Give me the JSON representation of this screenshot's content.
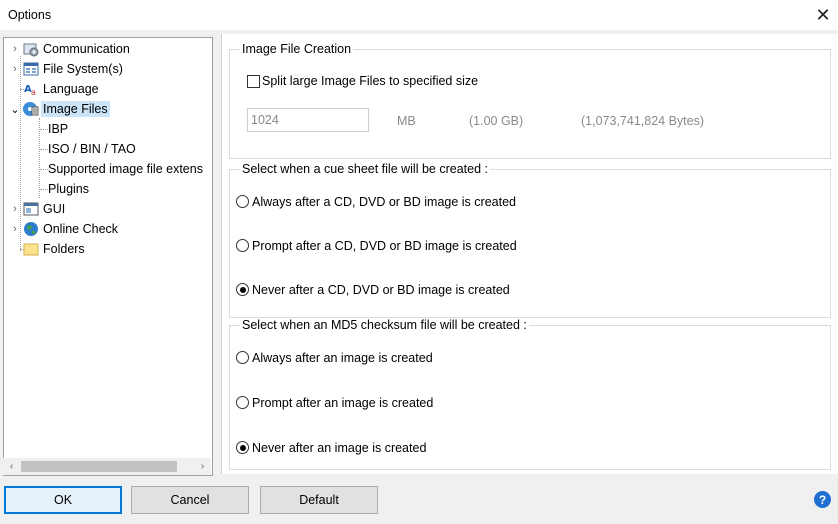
{
  "window": {
    "title": "Options",
    "close_glyph": "✕"
  },
  "tree": {
    "items": [
      {
        "label": "Communication",
        "icon": "network-settings-icon",
        "expander": "›"
      },
      {
        "label": "File System(s)",
        "icon": "filesystem-icon",
        "expander": "›"
      },
      {
        "label": "Language",
        "icon": "language-icon",
        "expander": ""
      },
      {
        "label": "Image Files",
        "icon": "disc-image-icon",
        "expander": "⌄"
      },
      {
        "label": "IBP"
      },
      {
        "label": "ISO / BIN / TAO"
      },
      {
        "label": "Supported image file extens"
      },
      {
        "label": "Plugins"
      },
      {
        "label": "GUI",
        "icon": "window-icon",
        "expander": "›"
      },
      {
        "label": "Online Check",
        "icon": "globe-icon",
        "expander": "›"
      },
      {
        "label": "Folders",
        "icon": "folder-icon",
        "expander": ""
      }
    ],
    "selected": "Image Files",
    "scroll_left": "‹",
    "scroll_right": "›"
  },
  "image_file_creation": {
    "legend": "Image File Creation",
    "split_label": "Split large Image Files to specified size",
    "split_checked": false,
    "size_value": "1024",
    "size_unit": "MB",
    "size_gb": "(1.00 GB)",
    "size_bytes": "(1,073,741,824 Bytes)"
  },
  "cue_sheet": {
    "legend": "Select when a cue sheet file will be created :",
    "options": [
      {
        "label": "Always after a CD, DVD or BD image is created",
        "selected": false
      },
      {
        "label": "Prompt after a CD, DVD or BD image is created",
        "selected": false
      },
      {
        "label": "Never after a CD, DVD or BD image is created",
        "selected": true
      }
    ]
  },
  "md5": {
    "legend": "Select when an MD5 checksum file will be created :",
    "options": [
      {
        "label": "Always after an image is created",
        "selected": false
      },
      {
        "label": "Prompt after an image is created",
        "selected": false
      },
      {
        "label": "Never after an image is created",
        "selected": true
      }
    ]
  },
  "buttons": {
    "ok": "OK",
    "cancel": "Cancel",
    "default": "Default",
    "help": "?"
  }
}
